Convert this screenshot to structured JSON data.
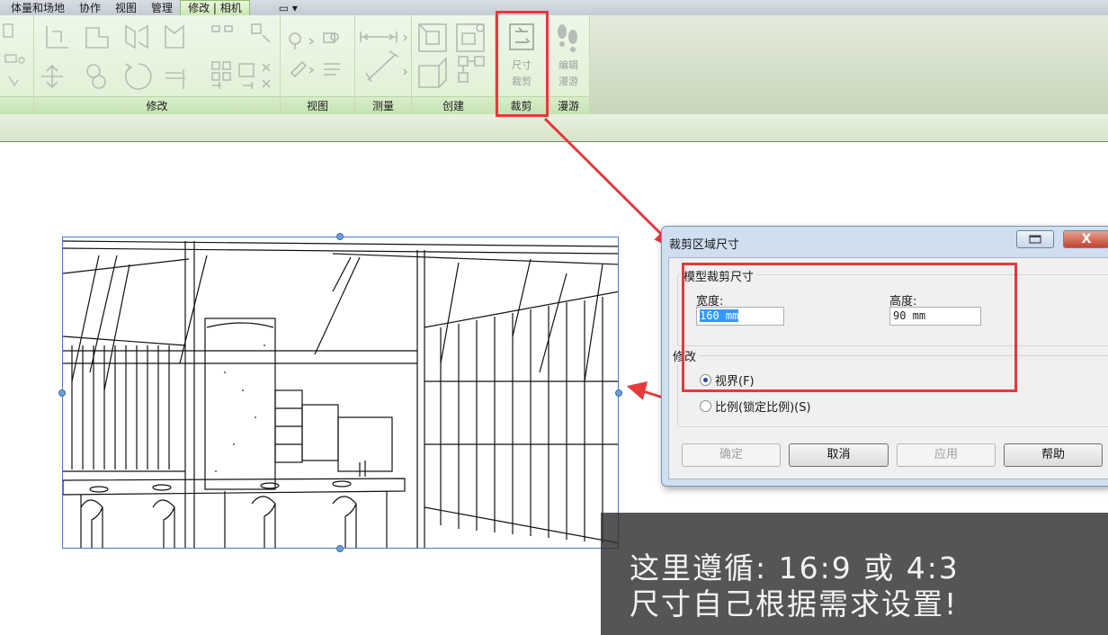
{
  "ribbon": {
    "tabs": [
      "体量和场地",
      "协作",
      "视图",
      "管理",
      "修改 | 相机",
      "▭ ▾"
    ],
    "active_tab": "修改 | 相机",
    "panels": {
      "modify": "修改",
      "view": "视图",
      "measure": "测量",
      "create": "创建",
      "crop": "裁剪",
      "walkthrough": "漫游"
    },
    "crop_button": {
      "line1": "尺寸",
      "line2": "裁剪"
    },
    "edit_walkthrough_button": {
      "line1": "编辑",
      "line2": "漫游"
    }
  },
  "dialog": {
    "title": "裁剪区域尺寸",
    "close_label": "X",
    "model_crop_group": "模型裁剪尺寸",
    "width_label": "宽度:",
    "width_value": "160 mm",
    "height_label": "高度:",
    "height_value": "90 mm",
    "modify_group": "修改",
    "radio_field_of_view": "视界(F)",
    "radio_scale": "比例(锁定比例)(S)",
    "buttons": {
      "ok": "确定",
      "cancel": "取消",
      "apply": "应用",
      "help": "帮助"
    }
  },
  "note": {
    "line1": "这里遵循: 16:9 或 4:3",
    "line2": "尺寸自己根据需求设置!"
  },
  "colors": {
    "highlight": "#e23b3b",
    "ribbon_bg": "#e4f1da",
    "crop_frame": "#4a78c2"
  }
}
